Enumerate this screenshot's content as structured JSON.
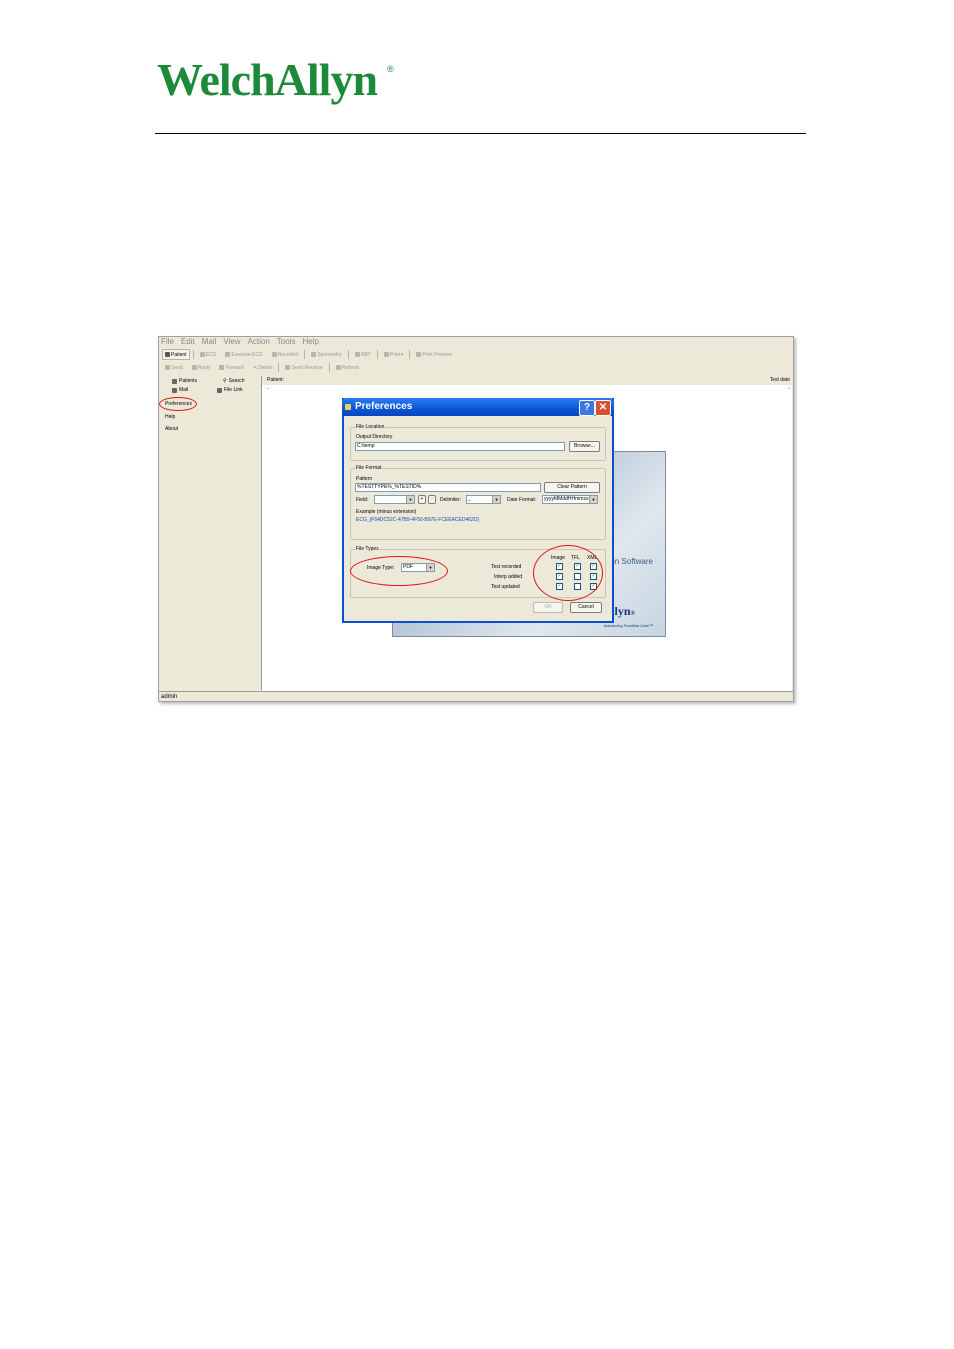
{
  "logo": {
    "text": "WelchAllyn",
    "reg": "®"
  },
  "app": {
    "menu": [
      "File",
      "Edit",
      "Mail",
      "View",
      "Action",
      "Tools",
      "Help"
    ],
    "toolbar1": [
      {
        "label": "Patient",
        "icon": "patient-icon",
        "active": true
      },
      {
        "label": "ECG",
        "icon": "ecg-icon"
      },
      {
        "label": "Exercise ECG",
        "icon": "exercise-icon"
      },
      {
        "label": "Recollect",
        "icon": "recollect-icon"
      },
      {
        "label": "Spirometry",
        "icon": "lungs-icon"
      },
      {
        "label": "ABP",
        "icon": "abp-icon"
      },
      {
        "label": "Print",
        "icon": "printer-icon"
      },
      {
        "label": "Print Preview",
        "icon": "preview-icon"
      }
    ],
    "toolbar2": [
      {
        "label": "Send",
        "icon": "send-icon"
      },
      {
        "label": "Reply",
        "icon": "reply-icon"
      },
      {
        "label": "Forward",
        "icon": "forward-icon"
      },
      {
        "label": "Delete",
        "icon": "delete-icon"
      },
      {
        "label": "Send Receive",
        "icon": "send-receive-icon"
      },
      {
        "label": "Refresh",
        "icon": "refresh-icon"
      }
    ],
    "nav": {
      "patients": "Patients",
      "search": "Search",
      "mail": "Mail",
      "file_link": "File Link"
    },
    "left_links": {
      "preferences": "Preferences",
      "help": "Help",
      "about": "About"
    },
    "patient_header": {
      "patient_label": "Patient:",
      "test_date_label": "Test date",
      "dash1": "-",
      "dash2": "-"
    },
    "status": "admin"
  },
  "splash": {
    "software_text": "on Software",
    "logo_text": "llyn",
    "logo_reg": "®",
    "tagline": "Advancing Frontline Care™"
  },
  "dialog": {
    "title": "Preferences",
    "help_glyph": "?",
    "close_glyph": "✕",
    "file_location": {
      "group": "File Location",
      "output_label": "Output Directory",
      "output_value": "C:\\temp",
      "browse": "Browse..."
    },
    "file_format": {
      "group": "File Format",
      "pattern_label": "Pattern",
      "pattern_value": "%TESTTYPE%_%TESTID%",
      "clear_pattern": "Clear Pattern",
      "field_label": "Field:",
      "field_value": "",
      "plus": "+",
      "minus": "-",
      "delimiter_label": "Delimiter:",
      "delimiter_value": "_",
      "date_format_label": "Date Format:",
      "date_format_value": "yyyyMMddHHmmss",
      "example_label": "Example (minus extension)",
      "example_value": "ECG_{F54DC52C-47B9-4F50-B97E-FCEEACED462D}"
    },
    "file_types": {
      "group": "File Types",
      "image_type_label": "Image Type:",
      "image_type_value": "PDF",
      "columns": [
        "Image",
        "TFL",
        "XML"
      ],
      "rows": [
        {
          "label": "Test recorded",
          "checks": [
            true,
            true,
            true
          ]
        },
        {
          "label": "Interp added",
          "checks": [
            true,
            false,
            true
          ]
        },
        {
          "label": "Test updated",
          "checks": [
            true,
            false,
            true
          ]
        }
      ]
    },
    "ok": "OK",
    "cancel": "Cancel"
  },
  "annotation_color": "#e0161b"
}
